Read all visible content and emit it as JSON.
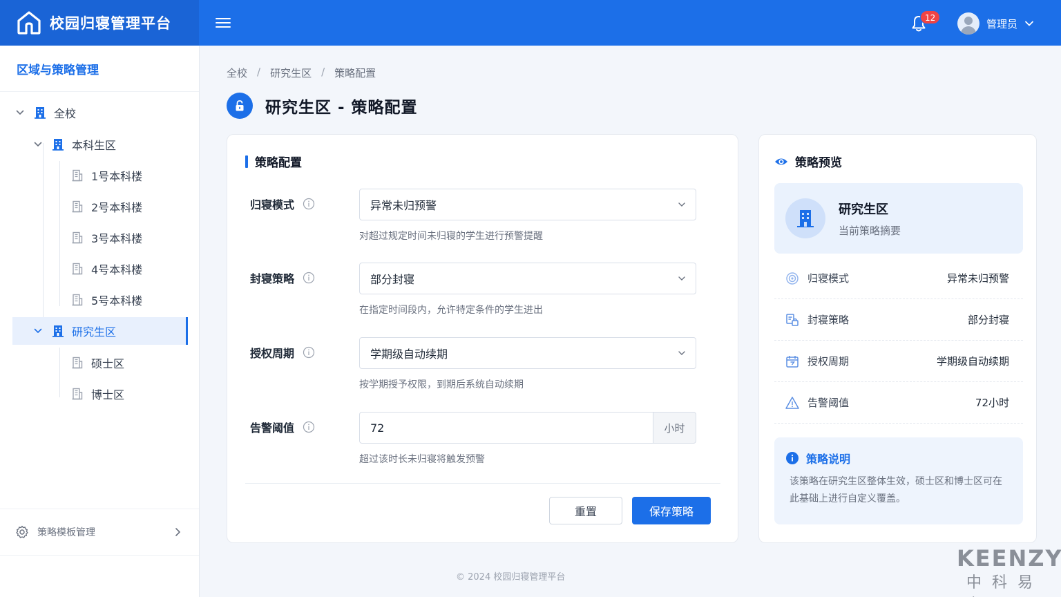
{
  "header": {
    "brand_title": "校园归寝管理平台",
    "notification_count": "12",
    "user_name": "管理员"
  },
  "sidebar": {
    "title": "区域与策略管理",
    "tree": [
      {
        "label": "全校",
        "level": 0,
        "expanded": true
      },
      {
        "label": "本科生区",
        "level": 1,
        "expanded": true
      },
      {
        "label": "1号本科楼",
        "level": 2
      },
      {
        "label": "2号本科楼",
        "level": 2
      },
      {
        "label": "3号本科楼",
        "level": 2
      },
      {
        "label": "4号本科楼",
        "level": 2
      },
      {
        "label": "5号本科楼",
        "level": 2
      },
      {
        "label": "研究生区",
        "level": 1,
        "expanded": true,
        "active": true
      },
      {
        "label": "硕士区",
        "level": 2
      },
      {
        "label": "博士区",
        "level": 2
      }
    ],
    "footer_label": "策略模板管理"
  },
  "breadcrumb": [
    "全校",
    "研究生区",
    "策略配置"
  ],
  "page_title": "研究生区 - 策略配置",
  "config": {
    "section_title": "策略配置",
    "fields": [
      {
        "label": "归寝模式",
        "value": "异常未归预警",
        "hint": "对超过规定时间未归寝的学生进行预警提醒"
      },
      {
        "label": "封寝策略",
        "value": "部分封寝",
        "hint": "在指定时间段内，允许特定条件的学生进出"
      },
      {
        "label": "授权周期",
        "value": "学期级自动续期",
        "hint": "按学期授予权限，到期后系统自动续期"
      },
      {
        "label": "告警阈值",
        "value": "72",
        "unit": "小时",
        "hint": "超过该时长未归寝将触发预警"
      }
    ],
    "reset_label": "重置",
    "save_label": "保存策略"
  },
  "preview": {
    "title": "策略预览",
    "zone_name": "研究生区",
    "zone_sub": "当前策略摘要",
    "rows": [
      {
        "label": "归寝模式",
        "value": "异常未归预警",
        "icon": "target-icon"
      },
      {
        "label": "封寝策略",
        "value": "部分封寝",
        "icon": "lock-doc-icon"
      },
      {
        "label": "授权周期",
        "value": "学期级自动续期",
        "icon": "calendar-icon"
      },
      {
        "label": "告警阈值",
        "value": "72小时",
        "icon": "warning-icon"
      }
    ],
    "note_title": "策略说明",
    "note_text": "该策略在研究生区整体生效，硕士区和博士区可在此基础上进行自定义覆盖。"
  },
  "footer": "© 2024 校园归寝管理平台",
  "watermark": {
    "en": "KEENZY",
    "cn": "中科易安"
  },
  "colors": {
    "primary": "#1c6fe8",
    "badge": "#ef4444"
  }
}
